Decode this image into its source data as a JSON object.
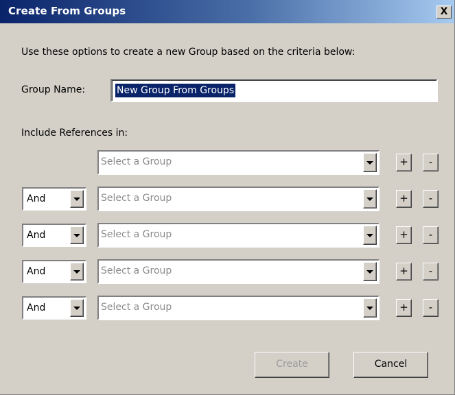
{
  "window": {
    "title": "Create From Groups",
    "close_label": "X"
  },
  "intro": "Use these options to create a new Group based on the criteria below:",
  "group_name": {
    "label": "Group Name:",
    "value": "New Group From Groups"
  },
  "include_label": "Include References in:",
  "rows": [
    {
      "operator": "",
      "group_placeholder": "Select a Group",
      "add_label": "+",
      "remove_label": "-"
    },
    {
      "operator": "And",
      "group_placeholder": "Select a Group",
      "add_label": "+",
      "remove_label": "-"
    },
    {
      "operator": "And",
      "group_placeholder": "Select a Group",
      "add_label": "+",
      "remove_label": "-"
    },
    {
      "operator": "And",
      "group_placeholder": "Select a Group",
      "add_label": "+",
      "remove_label": "-"
    },
    {
      "operator": "And",
      "group_placeholder": "Select a Group",
      "add_label": "+",
      "remove_label": "-"
    }
  ],
  "buttons": {
    "create": "Create",
    "cancel": "Cancel"
  },
  "colors": {
    "titlebar_start": "#0a246a",
    "titlebar_end": "#a6caf0",
    "face": "#d4d0c8",
    "selection": "#0a246a",
    "disabled_text": "#9a9a9a"
  }
}
